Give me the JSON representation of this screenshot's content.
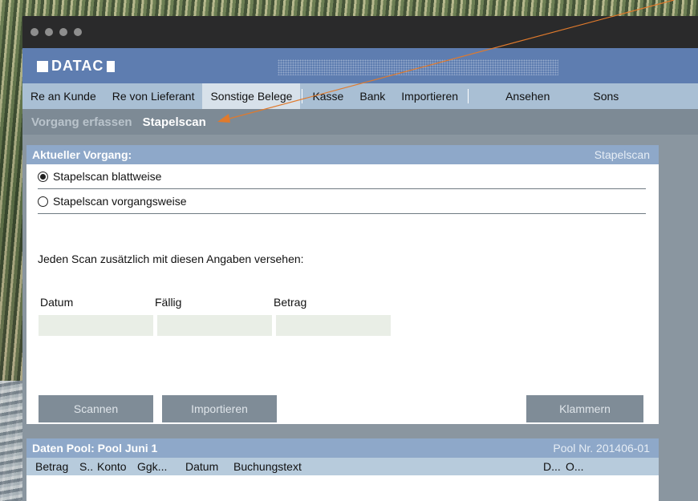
{
  "window": {
    "logo_text": "DATAC"
  },
  "menu": {
    "items": [
      "Re an Kunde",
      "Re von Lieferant",
      "Sonstige Belege",
      "Kasse",
      "Bank",
      "Importieren",
      "Ansehen",
      "Sons"
    ],
    "active_index": 2
  },
  "subtabs": {
    "items": [
      "Vorgang erfassen",
      "Stapelscan"
    ],
    "active_index": 1
  },
  "current_process": {
    "title": "Aktueller Vorgang:",
    "right_label": "Stapelscan",
    "options": [
      {
        "label": "Stapelscan blattweise",
        "checked": true
      },
      {
        "label": "Stapelscan vorgangsweise",
        "checked": false
      }
    ],
    "note": "Jeden Scan zusätzlich mit diesen Angaben versehen:",
    "fields": [
      {
        "label": "Datum",
        "value": ""
      },
      {
        "label": "Fällig",
        "value": ""
      },
      {
        "label": "Betrag",
        "value": ""
      }
    ],
    "buttons": {
      "scan": "Scannen",
      "import": "Importieren",
      "staple": "Klammern"
    }
  },
  "pool": {
    "title": "Daten Pool: Pool Juni 1",
    "number": "Pool Nr. 201406-01",
    "columns": [
      "Betrag",
      "S..",
      "Konto",
      "Ggk...",
      "Datum",
      "Buchungstext",
      "D...",
      "O..."
    ]
  },
  "colors": {
    "accent_arrow": "#e07a2c",
    "header_blue": "#5e7db0",
    "panel_head": "#8ea8c9"
  }
}
